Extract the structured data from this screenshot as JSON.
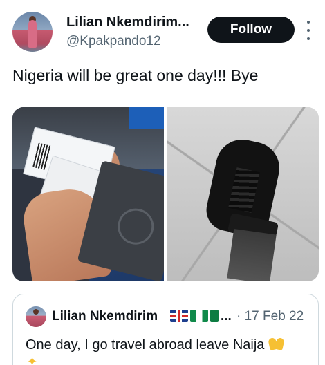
{
  "tweet": {
    "author_name": "Lilian Nkemdirim...",
    "author_handle": "@Kpakpando12",
    "follow_label": "Follow",
    "text": "Nigeria will be great one day!!! Bye",
    "more_icon": "more-horizontal-icon"
  },
  "media": {
    "images": [
      {
        "name": "boarding-pass-passport-photo"
      },
      {
        "name": "black-boot-photo"
      }
    ]
  },
  "quoted_tweet": {
    "author_name": "Lilian Nkemdirim",
    "flags": [
      "uk-flag",
      "nigeria-flag"
    ],
    "ellipsis": "...",
    "date": "· 17 Feb 22",
    "text": "One day, I go travel abroad leave Naija",
    "emoji": [
      "raised-hands-icon",
      "sparkles-icon"
    ]
  },
  "colors": {
    "text_primary": "#0f1419",
    "text_secondary": "#536471",
    "follow_bg": "#0f1419",
    "border": "#cfd9de"
  }
}
